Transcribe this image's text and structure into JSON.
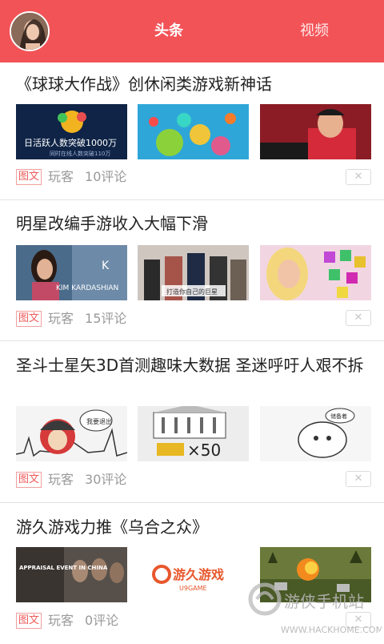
{
  "header": {
    "tabs": [
      {
        "label": "头条",
        "active": true
      },
      {
        "label": "视频",
        "active": false
      }
    ]
  },
  "articles": [
    {
      "title": "《球球大作战》创休闲类游戏新神话",
      "tag": "图文",
      "source": "玩客",
      "comments": "10评论",
      "thumbs": [
        {
          "caption": "日活跃人数突破1000万",
          "subcaption": "同时在线人数突破110万"
        },
        {},
        {}
      ]
    },
    {
      "title": "明星改编手游收入大幅下滑",
      "tag": "图文",
      "source": "玩客",
      "comments": "15评论",
      "thumbs": [
        {
          "caption": "KIM KARDASHIAN"
        },
        {
          "caption": "打造你自己的巨星"
        },
        {}
      ]
    },
    {
      "title": "圣斗士星矢3D首测趣味大数据 圣迷呼吁人艰不拆",
      "tag": "图文",
      "source": "玩客",
      "comments": "30评论",
      "thumbs": [
        {
          "caption": "我要退出"
        },
        {
          "caption": "×50"
        },
        {
          "caption": "储备着"
        }
      ]
    },
    {
      "title": "游久游戏力推《乌合之众》",
      "tag": "图文",
      "source": "玩客",
      "comments": "0评论",
      "thumbs": [
        {
          "caption": "APPRAISAL EVENT IN CHINA"
        },
        {
          "caption": "游久游戏",
          "subcaption": "U9GAME"
        },
        {}
      ]
    }
  ],
  "watermark": {
    "name": "游侠手机站",
    "url": "WWW.HACKHOME.COM"
  },
  "colors": {
    "header": "#f25357",
    "tag": "#ef5a5a",
    "meta": "#999999"
  }
}
